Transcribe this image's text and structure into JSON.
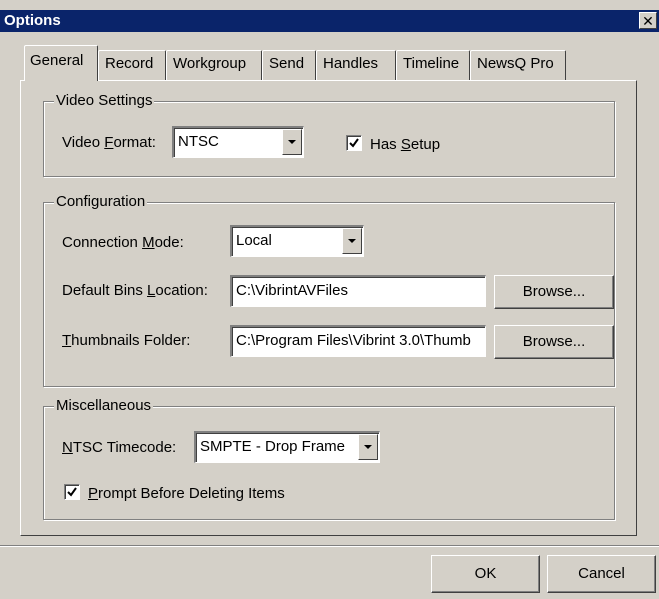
{
  "window": {
    "title": "Options",
    "close_glyph": "✕"
  },
  "tabs": [
    {
      "label": "General",
      "active": true
    },
    {
      "label": "Record",
      "active": false
    },
    {
      "label": "Workgroup",
      "active": false
    },
    {
      "label": "Send",
      "active": false
    },
    {
      "label": "Handles",
      "active": false
    },
    {
      "label": "Timeline",
      "active": false
    },
    {
      "label": "NewsQ Pro",
      "active": false
    }
  ],
  "video_settings": {
    "title": "Video Settings",
    "format_label_pre": "Video ",
    "format_label_u": "F",
    "format_label_post": "ormat:",
    "format_value": "NTSC",
    "has_setup_pre": "Has ",
    "has_setup_u": "S",
    "has_setup_post": "etup",
    "has_setup_checked": true
  },
  "configuration": {
    "title": "Configuration",
    "connection_label_pre": "Connection ",
    "connection_label_u": "M",
    "connection_label_post": "ode:",
    "connection_value": "Local",
    "bins_label_pre": "Default Bins ",
    "bins_label_u": "L",
    "bins_label_post": "ocation:",
    "bins_value": "C:\\VibrintAVFiles",
    "thumbs_label_u": "T",
    "thumbs_label_post": "humbnails Folder:",
    "thumbs_value": "C:\\Program Files\\Vibrint 3.0\\Thumb",
    "browse_label": "Browse..."
  },
  "miscellaneous": {
    "title": "Miscellaneous",
    "timecode_label_u": "N",
    "timecode_label_post": "TSC Timecode:",
    "timecode_value": "SMPTE - Drop Frame",
    "prompt_label_u": "P",
    "prompt_label_post": "rompt Before Deleting Items",
    "prompt_checked": true
  },
  "footer": {
    "ok_label": "OK",
    "cancel_label": "Cancel"
  }
}
